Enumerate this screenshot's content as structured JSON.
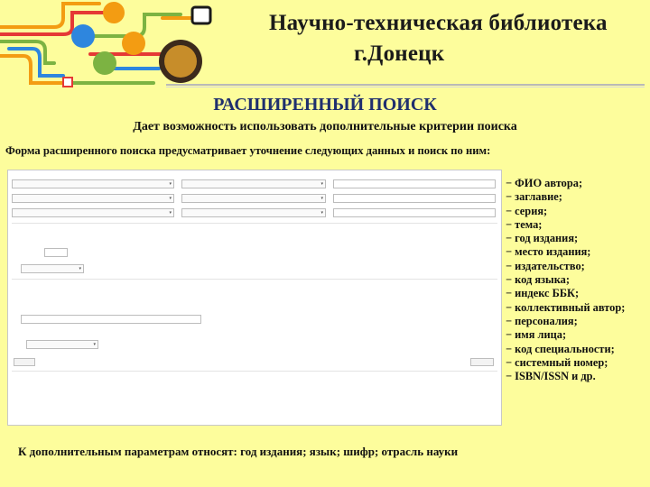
{
  "header": {
    "title_line1": "Научно-техническая библиотека",
    "title_line2": "г.Донецк"
  },
  "slide": {
    "subtitle": "РАСШИРЕННЫЙ ПОИСК",
    "description": "Дает возможность использовать дополнительные критерии поиска",
    "form_description": "Форма расширенного поиска предусматривает уточнение следующих данных и поиск по ним:",
    "footer_note": "К дополнительным параметрам относят: год издания; язык; шифр; отрасль науки"
  },
  "fields": [
    "− ФИО автора;",
    "− заглавие;",
    "− серия;",
    "− тема;",
    "− год издания;",
    "− место издания;",
    "− издательство;",
    "− код языка;",
    "− индекс ББК;",
    "− коллективный автор;",
    "− персоналия;",
    "− имя лица;",
    "− код специальности;",
    "− системный номер;",
    "− ISBN/ISSN и др."
  ],
  "colors": {
    "background": "#fdfd9c",
    "subtitle": "#1f2f6e",
    "link": "#3a63b3",
    "logo_orange": "#f39c12",
    "logo_blue": "#2e86de",
    "logo_green": "#7cb342",
    "logo_red": "#e53935"
  }
}
